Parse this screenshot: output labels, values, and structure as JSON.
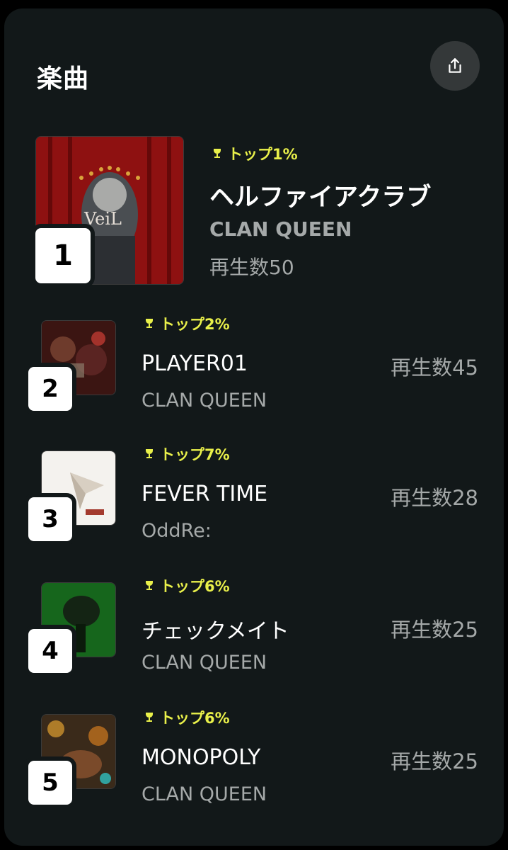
{
  "header": {
    "title": "楽曲",
    "share_icon": "share-icon"
  },
  "colors": {
    "background": "#121819",
    "badge": "#e9f04a",
    "secondary_text": "#a5a9a9"
  },
  "tracks": [
    {
      "rank": "1",
      "badge": "トップ1%",
      "title": "ヘルファイアクラブ",
      "artist": "CLAN QUEEN",
      "plays": "再生数50"
    },
    {
      "rank": "2",
      "badge": "トップ2%",
      "title": "PLAYER01",
      "artist": "CLAN QUEEN",
      "plays": "再生数45"
    },
    {
      "rank": "3",
      "badge": "トップ7%",
      "title": "FEVER TIME",
      "artist": "OddRe:",
      "plays": "再生数28"
    },
    {
      "rank": "4",
      "badge": "トップ6%",
      "title": "チェックメイト",
      "artist": "CLAN QUEEN",
      "plays": "再生数25"
    },
    {
      "rank": "5",
      "badge": "トップ6%",
      "title": "MONOPOLY",
      "artist": "CLAN QUEEN",
      "plays": "再生数25"
    }
  ]
}
